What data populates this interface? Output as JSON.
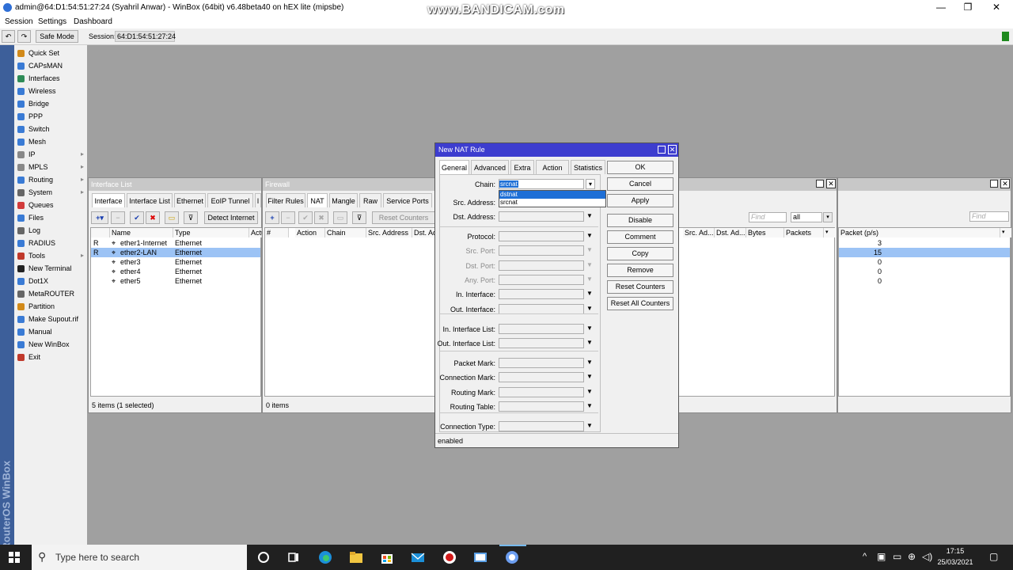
{
  "window": {
    "title": "admin@64:D1:54:51:27:24 (Syahril Anwar) - WinBox (64bit) v6.48beta40 on hEX lite (mipsbe)",
    "watermark": "www.BANDICAM.com",
    "controls": [
      "—",
      "❐",
      "✕"
    ]
  },
  "menu": [
    "Session",
    "Settings",
    "Dashboard"
  ],
  "toolbar": {
    "safe_mode": "Safe Mode",
    "session_label": "Session:",
    "session_value": "64:D1:54:51:27:24"
  },
  "sidebar": {
    "brand": "RouterOS WinBox",
    "items": [
      {
        "label": "Quick Set",
        "color": "#d28a1a"
      },
      {
        "label": "CAPsMAN",
        "color": "#3a7bd5"
      },
      {
        "label": "Interfaces",
        "color": "#2e8b57"
      },
      {
        "label": "Wireless",
        "color": "#3a7bd5"
      },
      {
        "label": "Bridge",
        "color": "#3a7bd5"
      },
      {
        "label": "PPP",
        "color": "#3a7bd5"
      },
      {
        "label": "Switch",
        "color": "#3a7bd5"
      },
      {
        "label": "Mesh",
        "color": "#3a7bd5"
      },
      {
        "label": "IP",
        "color": "#888888",
        "sub": true
      },
      {
        "label": "MPLS",
        "color": "#888888",
        "sub": true
      },
      {
        "label": "Routing",
        "color": "#3a7bd5",
        "sub": true
      },
      {
        "label": "System",
        "color": "#666666",
        "sub": true
      },
      {
        "label": "Queues",
        "color": "#d23b3b"
      },
      {
        "label": "Files",
        "color": "#3a7bd5"
      },
      {
        "label": "Log",
        "color": "#666666"
      },
      {
        "label": "RADIUS",
        "color": "#3a7bd5"
      },
      {
        "label": "Tools",
        "color": "#c0392b",
        "sub": true
      },
      {
        "label": "New Terminal",
        "color": "#222222"
      },
      {
        "label": "Dot1X",
        "color": "#3a7bd5"
      },
      {
        "label": "MetaROUTER",
        "color": "#666666"
      },
      {
        "label": "Partition",
        "color": "#d28a1a"
      },
      {
        "label": "Make Supout.rif",
        "color": "#3a7bd5"
      },
      {
        "label": "Manual",
        "color": "#3a7bd5"
      },
      {
        "label": "New WinBox",
        "color": "#3a7bd5"
      },
      {
        "label": "Exit",
        "color": "#c0392b"
      }
    ]
  },
  "interface_list": {
    "title": "Interface List",
    "tabs": [
      "Interface",
      "Interface List",
      "Ethernet",
      "EoIP Tunnel",
      "I"
    ],
    "detect_button": "Detect Internet",
    "columns": [
      "Name",
      "Type",
      "Actu"
    ],
    "rows": [
      {
        "flag": "R",
        "name": "ether1-Internet",
        "type": "Ethernet"
      },
      {
        "flag": "R",
        "name": "ether2-LAN",
        "type": "Ethernet",
        "selected": true
      },
      {
        "flag": "",
        "name": "ether3",
        "type": "Ethernet"
      },
      {
        "flag": "",
        "name": "ether4",
        "type": "Ethernet"
      },
      {
        "flag": "",
        "name": "ether5",
        "type": "Ethernet"
      }
    ],
    "status": "5 items (1 selected)"
  },
  "firewall": {
    "title": "Firewall",
    "tabs": [
      "Filter Rules",
      "NAT",
      "Mangle",
      "Raw",
      "Service Ports"
    ],
    "reset_button": "Reset Counters",
    "columns": [
      "#",
      "Action",
      "Chain",
      "Src. Address",
      "Dst. Ad",
      "Src. Ad...",
      "Dst. Ad...",
      "Bytes",
      "Packets"
    ],
    "find_placeholder": "Find",
    "filter_value": "all",
    "status": "0 items"
  },
  "right_panel": {
    "find_placeholder": "Find",
    "column": "Packet (p/s)",
    "values": [
      "3",
      "15",
      "0",
      "0",
      "0"
    ]
  },
  "dialog": {
    "title": "New NAT Rule",
    "tabs": [
      "General",
      "Advanced",
      "Extra",
      "Action",
      "Statistics"
    ],
    "chain_label": "Chain:",
    "chain_value": "srcnat",
    "chain_options": [
      "dstnat",
      "srcnat"
    ],
    "fields": [
      "Src. Address:",
      "Dst. Address:",
      "Protocol:",
      "Src. Port:",
      "Dst. Port:",
      "Any. Port:",
      "In. Interface:",
      "Out. Interface:",
      "In. Interface List:",
      "Out. Interface List:",
      "Packet Mark:",
      "Connection Mark:",
      "Routing Mark:",
      "Routing Table:",
      "Connection Type:"
    ],
    "buttons": [
      "OK",
      "Cancel",
      "Apply",
      "Disable",
      "Comment",
      "Copy",
      "Remove",
      "Reset Counters",
      "Reset All Counters"
    ],
    "status": "enabled"
  },
  "taskbar": {
    "search_placeholder": "Type here to search",
    "time": "17:15",
    "date": "25/03/2021"
  }
}
